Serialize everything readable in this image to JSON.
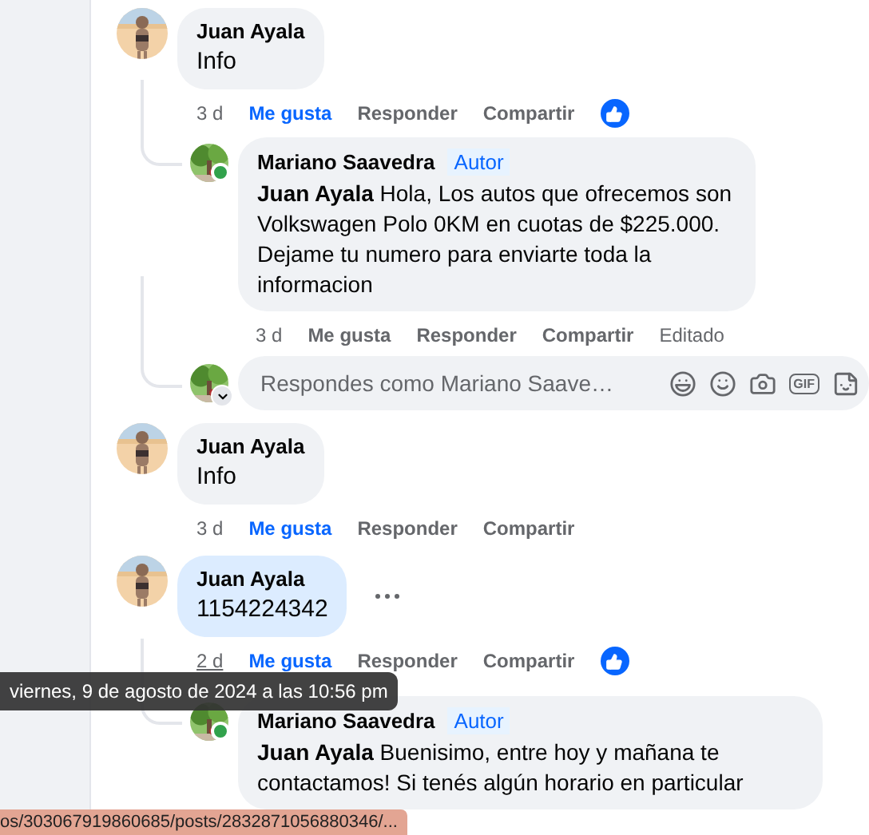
{
  "comments": [
    {
      "author": "Juan Ayala",
      "text": "Info",
      "highlighted": false,
      "more_button": false,
      "time": "3 d",
      "time_hovered": false,
      "actions": [
        "Me gusta",
        "Responder",
        "Compartir"
      ],
      "liked": true,
      "has_reaction": true,
      "replies": [
        {
          "author": "Mariano Saavedra",
          "badge": "Autor",
          "text": "**Juan Ayala** Hola, Los autos que ofrecemos son Volkswagen Polo 0KM en cuotas de $225.000. Dejame tu numero para enviarte toda la informacion",
          "online": true,
          "time": "3 d",
          "actions": [
            "Me gusta",
            "Responder",
            "Compartir"
          ],
          "liked": false,
          "edited": "Editado"
        }
      ],
      "reply_field": {
        "placeholder": "Respondes como Mariano Saave…",
        "gif_label": "GIF"
      }
    },
    {
      "author": "Juan Ayala",
      "text": "Info",
      "highlighted": false,
      "more_button": false,
      "time": "3 d",
      "time_hovered": false,
      "actions": [
        "Me gusta",
        "Responder",
        "Compartir"
      ],
      "liked": true,
      "has_reaction": false
    },
    {
      "author": "Juan Ayala",
      "text": "1154224342",
      "highlighted": true,
      "more_button": true,
      "time": "2 d",
      "time_hovered": true,
      "actions": [
        "Me gusta",
        "Responder",
        "Compartir"
      ],
      "liked": true,
      "has_reaction": true,
      "replies": [
        {
          "author": "Mariano Saavedra",
          "badge": "Autor",
          "text": "**Juan Ayala** Buenisimo, entre hoy y mañana te contactamos! Si tenés algún horario en particular",
          "online": true
        }
      ]
    }
  ],
  "tooltip": "viernes, 9 de agosto de 2024 a las 10:56 pm",
  "status_bar": "os/303067919860685/posts/2832871056880346/..."
}
